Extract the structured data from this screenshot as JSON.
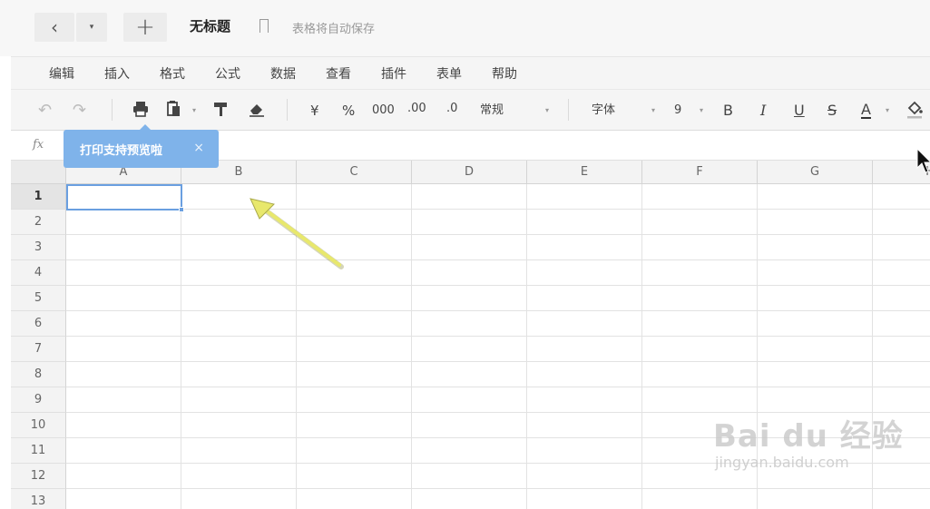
{
  "titlebar": {
    "back_icon": "‹",
    "dropdown_icon": "▾",
    "new_icon": "+",
    "doc_title": "无标题",
    "autosave_text": "表格将自动保存"
  },
  "menu": [
    "编辑",
    "插入",
    "格式",
    "公式",
    "数据",
    "查看",
    "插件",
    "表单",
    "帮助"
  ],
  "toolbar": {
    "undo": "↶",
    "redo": "↷",
    "currency": "¥",
    "percent": "%",
    "thousands": "000",
    "decimal_increase": ".00",
    "decimal_decrease": ".0",
    "number_format": "常规",
    "font_family": "字体",
    "font_size": "9",
    "bold": "B",
    "italic": "I",
    "underline": "U",
    "strike": "S",
    "font_color": "A",
    "caret": "▾"
  },
  "formula": {
    "label": "fx"
  },
  "tooltip": {
    "text": "打印支持预览啦",
    "close": "×"
  },
  "grid": {
    "columns": [
      "A",
      "B",
      "C",
      "D",
      "E",
      "F",
      "G",
      "H"
    ],
    "rows": [
      "1",
      "2",
      "3",
      "4",
      "5",
      "6",
      "7",
      "8",
      "9",
      "10",
      "11",
      "12",
      "13"
    ],
    "selected_cell": "A1"
  },
  "watermark": {
    "brand": "Bai du 经验",
    "url": "jingyan.baidu.com"
  },
  "colors": {
    "accent": "#6a9fe0",
    "tooltip_bg": "#7fb3ea",
    "annotation_arrow": "#e6e66a"
  }
}
